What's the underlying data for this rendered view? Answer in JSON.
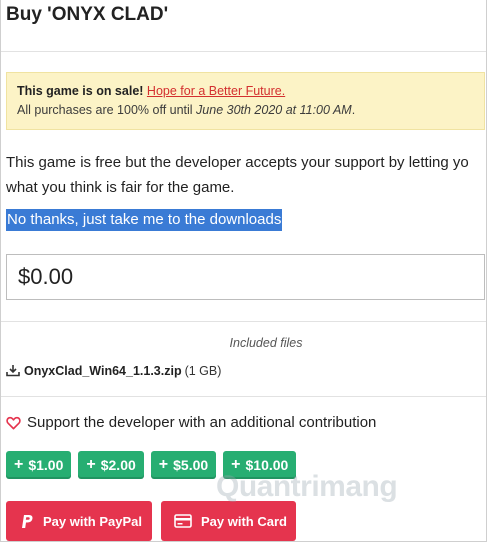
{
  "header": {
    "title": "Buy 'ONYX CLAD'"
  },
  "sale": {
    "lead": "This game is on sale!",
    "link": "Hope for a Better Future.",
    "text_before": "All purchases are 100% off until ",
    "date": "June 30th 2020 at 11:00 AM",
    "text_after": "."
  },
  "description": {
    "line1": "This game is free but the developer accepts your support by letting yo",
    "line2": "what you think is fair for the game."
  },
  "no_thanks_link": "No thanks, just take me to the downloads",
  "price_input": {
    "value": "$0.00"
  },
  "files": {
    "label": "Included files",
    "items": [
      {
        "name": "OnyxClad_Win64_1.1.3.zip",
        "size": "(1 GB)",
        "icon": "download-icon"
      }
    ]
  },
  "support": {
    "icon": "heart-icon",
    "label": "Support the developer with an additional contribution",
    "tips": [
      {
        "label": "$1.00"
      },
      {
        "label": "$2.00"
      },
      {
        "label": "$5.00"
      },
      {
        "label": "$10.00"
      }
    ]
  },
  "payment": {
    "paypal_label": "Pay with PayPal",
    "card_label": "Pay with Card"
  },
  "watermark": "Quantrimang",
  "colors": {
    "sale_bg": "#fcf3c6",
    "link_red": "#d32f2f",
    "selection_blue": "#3a7bd5",
    "tip_green": "#27ae72",
    "pay_red": "#e5344e"
  }
}
